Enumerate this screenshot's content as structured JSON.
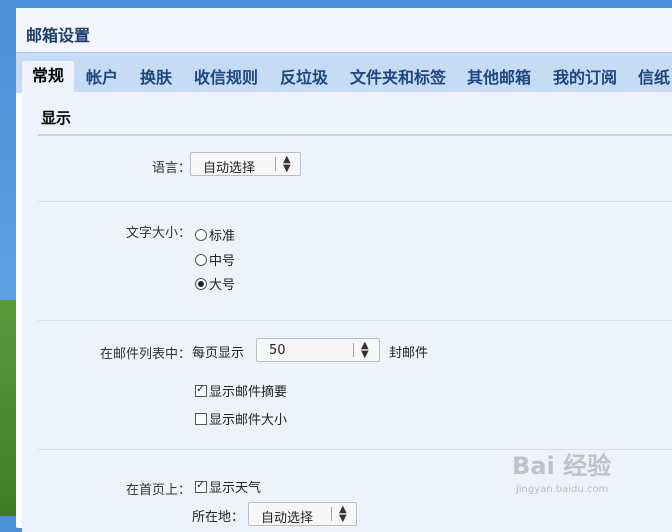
{
  "window": {
    "title": "邮箱设置"
  },
  "tabs": [
    "常规",
    "帐户",
    "换肤",
    "收信规则",
    "反垃圾",
    "文件夹和标签",
    "其他邮箱",
    "我的订阅",
    "信纸"
  ],
  "section": {
    "title": "显示"
  },
  "language": {
    "label": "语言：",
    "value": "自动选择"
  },
  "font_size": {
    "label": "文字大小：",
    "options": [
      "标准",
      "中号",
      "大号"
    ],
    "selected": "大号"
  },
  "mail_list": {
    "label": "在邮件列表中：",
    "per_page_prefix": "每页显示",
    "per_page_value": "50",
    "per_page_suffix": "封邮件",
    "show_summary": {
      "label": "显示邮件摘要",
      "checked": true
    },
    "show_size": {
      "label": "显示邮件大小",
      "checked": false
    }
  },
  "homepage": {
    "label": "在首页上：",
    "show_weather": {
      "label": "显示天气",
      "checked": true
    },
    "location_label": "所在地：",
    "location_value": "自动选择"
  },
  "watermark": {
    "main": "Bai 经验",
    "sub": "jingyan.baidu.com"
  }
}
